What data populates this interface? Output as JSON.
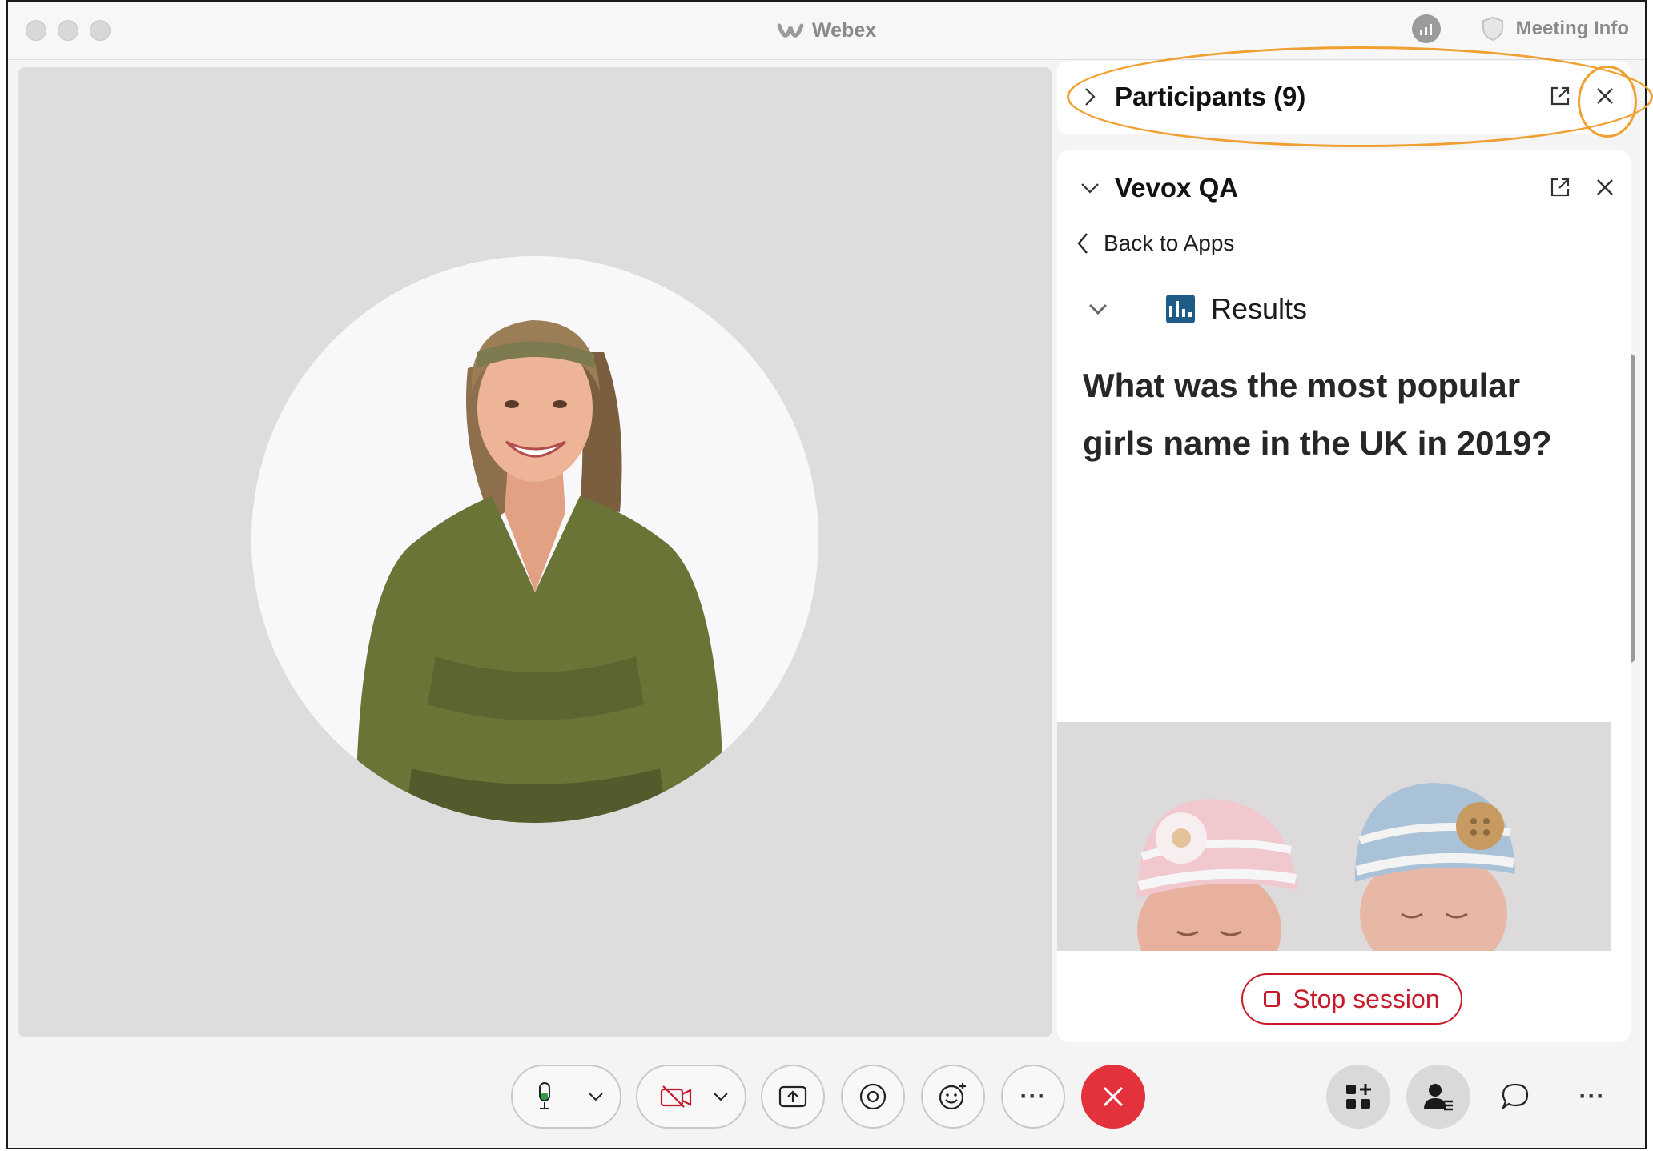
{
  "window": {
    "title": "Webex",
    "meeting_info_label": "Meeting Info"
  },
  "panels": {
    "participants": {
      "title": "Participants (9)"
    },
    "vevox": {
      "title": "Vevox QA",
      "back_label": "Back to Apps",
      "section_label": "Results",
      "question": "What was the most popular girls name in the UK in 2019?",
      "stop_label": "Stop session"
    }
  },
  "toolbar": {
    "more_label": "···",
    "more_right_label": "···"
  },
  "colors": {
    "accent_highlight": "#f0a030",
    "end_call": "#e3323c",
    "stop_session": "#c71a2a",
    "results_icon": "#1d5c86"
  },
  "icons": {
    "mute": "microphone-icon",
    "video": "video-off-icon",
    "share": "share-screen-icon",
    "record": "record-icon",
    "reactions": "emoji-icon",
    "apps": "apps-icon",
    "participants": "participants-icon",
    "chat": "chat-icon"
  }
}
